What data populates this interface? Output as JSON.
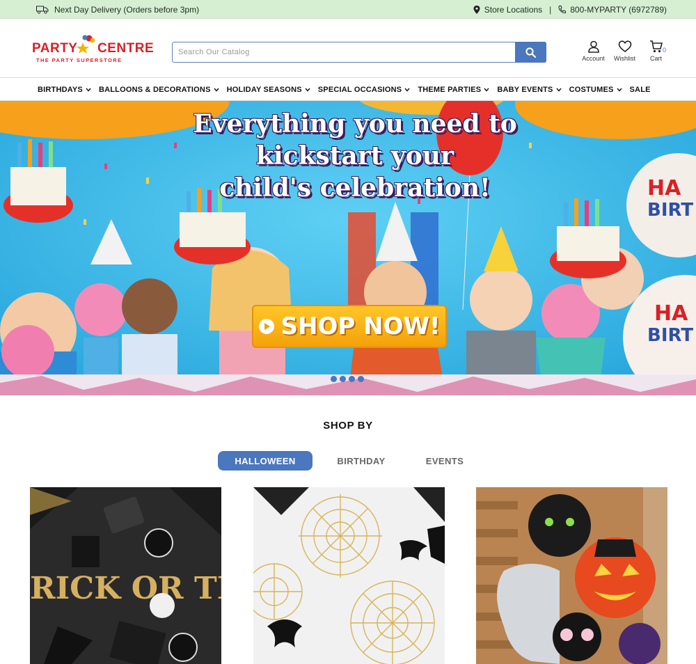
{
  "topbar": {
    "delivery": "Next Day Delivery (Orders before 3pm)",
    "store_locations": "Store Locations",
    "separator": "|",
    "phone": "800-MYPARTY (6972789)"
  },
  "logo": {
    "word1": "PARTY",
    "word2": "CENTRE",
    "tagline": "THE PARTY SUPERSTORE"
  },
  "search": {
    "placeholder": "Search Our Catalog"
  },
  "header_actions": {
    "account": "Account",
    "wishlist": "Wishlist",
    "cart": "Cart",
    "cart_count": "0"
  },
  "nav": {
    "items": [
      {
        "label": "BIRTHDAYS"
      },
      {
        "label": "BALLOONS & DECORATIONS"
      },
      {
        "label": "HOLIDAY SEASONS"
      },
      {
        "label": "SPECIAL OCCASIONS"
      },
      {
        "label": "THEME PARTIES"
      },
      {
        "label": "BABY EVENTS"
      },
      {
        "label": "COSTUMES"
      },
      {
        "label": "SALE"
      }
    ]
  },
  "hero": {
    "line1": "Everything you need to",
    "line2": "kickstart your",
    "line3": "child's celebration!",
    "cta": "SHOP NOW!",
    "slides": 4
  },
  "shop_by": {
    "title": "SHOP BY",
    "tabs": [
      {
        "label": "HALLOWEEN"
      },
      {
        "label": "BIRTHDAY"
      },
      {
        "label": "EVENTS"
      }
    ]
  },
  "colors": {
    "topbar_bg": "#d6efd3",
    "brand_red": "#d92027",
    "accent_blue": "#4a77bd",
    "cta_orange": "#f4a10a"
  },
  "icons": {
    "delivery": "truck-icon",
    "store": "map-pin-icon",
    "phone": "phone-icon",
    "search": "search-icon",
    "account": "user-icon",
    "wishlist": "heart-icon",
    "cart": "cart-icon",
    "dropdown": "chevron-down-icon",
    "cta": "play-icon"
  }
}
